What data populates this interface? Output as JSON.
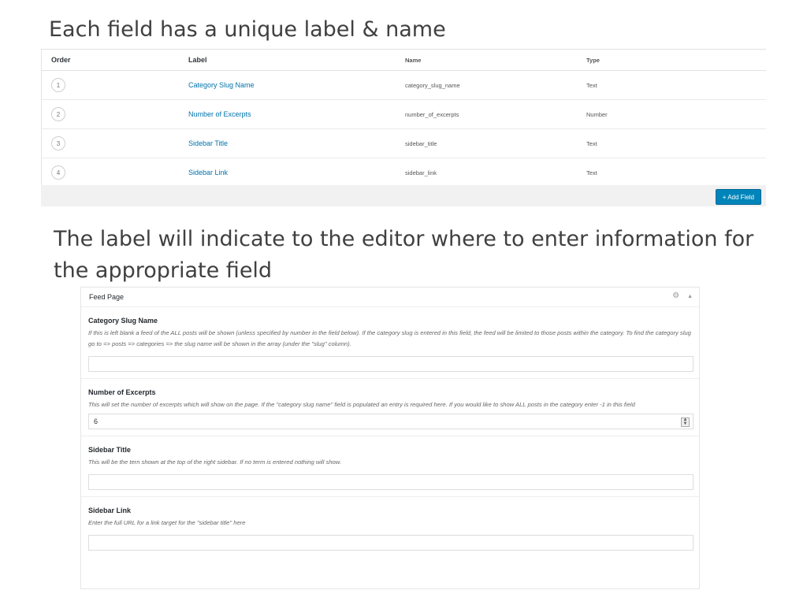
{
  "slide": {
    "title1": "Each field has a unique label & name",
    "title2": "The label will indicate to the editor where to enter information for the appropriate field"
  },
  "fields_table": {
    "headers": {
      "order": "Order",
      "label": "Label",
      "name": "Name",
      "type": "Type"
    },
    "rows": [
      {
        "order": "1",
        "label": "Category Slug Name",
        "name": "category_slug_name",
        "type": "Text"
      },
      {
        "order": "2",
        "label": "Number of Excerpts",
        "name": "number_of_excerpts",
        "type": "Number"
      },
      {
        "order": "3",
        "label": "Sidebar Title",
        "name": "sidebar_title",
        "type": "Text"
      },
      {
        "order": "4",
        "label": "Sidebar Link",
        "name": "sidebar_link",
        "type": "Text"
      }
    ],
    "add_button": "+ Add Field"
  },
  "feed_page": {
    "title": "Feed Page",
    "icons": [
      "gear-icon",
      "collapse-arrow-icon"
    ],
    "fields": [
      {
        "label": "Category Slug Name",
        "description": "If this is left blank a feed of the ALL posts will be shown (unless specified by number in the field below). If the category slug is entered in this field, the feed will be limited to those posts within the category. To find the category slug go to => posts => categories => the slug name will be shown in the array (under the \"slug\" column).",
        "value": ""
      },
      {
        "label": "Number of Excerpts",
        "description": "This will set the number of excerpts which will show on the page. If the \"category slug name\" field is populated an entry is required here. If you would like to show ALL posts in the category enter -1 in this field",
        "value": "6"
      },
      {
        "label": "Sidebar Title",
        "description": "This will be the tern shown at the top of the right sidebar. If no term is entered nothing will show.",
        "value": ""
      },
      {
        "label": "Sidebar Link",
        "description": "Enter the full URL for a link target for the \"sidebar title\" here",
        "value": ""
      }
    ]
  }
}
